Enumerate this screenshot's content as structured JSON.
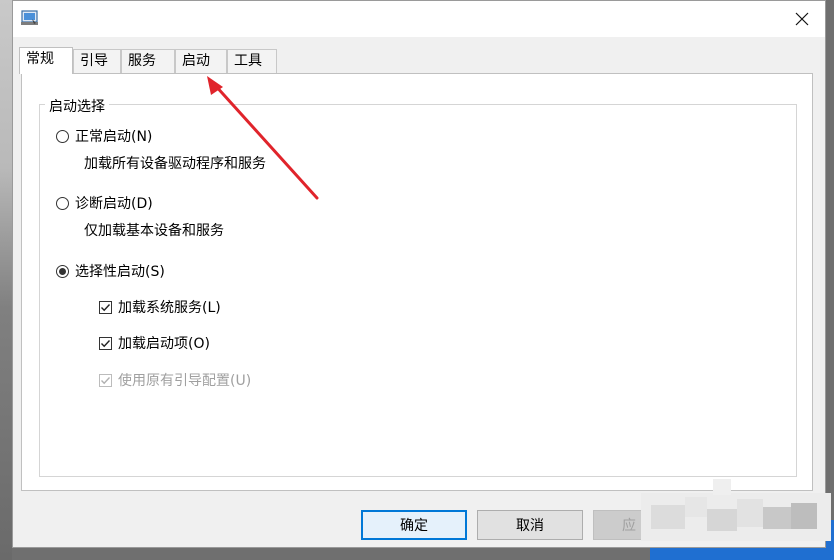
{
  "window": {
    "icon": "msconfig-icon",
    "close_icon": "close-icon"
  },
  "tabs": [
    {
      "label": "常规",
      "active": true
    },
    {
      "label": "引导",
      "active": false
    },
    {
      "label": "服务",
      "active": false
    },
    {
      "label": "启动",
      "active": false
    },
    {
      "label": "工具",
      "active": false
    }
  ],
  "startup_selection": {
    "legend": "启动选择",
    "options": [
      {
        "label": "正常启动(N)",
        "description": "加载所有设备驱动程序和服务",
        "selected": false
      },
      {
        "label": "诊断启动(D)",
        "description": "仅加载基本设备和服务",
        "selected": false
      },
      {
        "label": "选择性启动(S)",
        "selected": true
      }
    ],
    "selective_items": [
      {
        "label": "加载系统服务(L)",
        "checked": true,
        "enabled": true
      },
      {
        "label": "加载启动项(O)",
        "checked": true,
        "enabled": true
      },
      {
        "label": "使用原有引导配置(U)",
        "checked": true,
        "enabled": false
      }
    ]
  },
  "buttons": {
    "ok": "确定",
    "cancel": "取消",
    "apply": "应"
  },
  "annotation": {
    "arrow_color": "#e0242b",
    "target": "启动"
  }
}
